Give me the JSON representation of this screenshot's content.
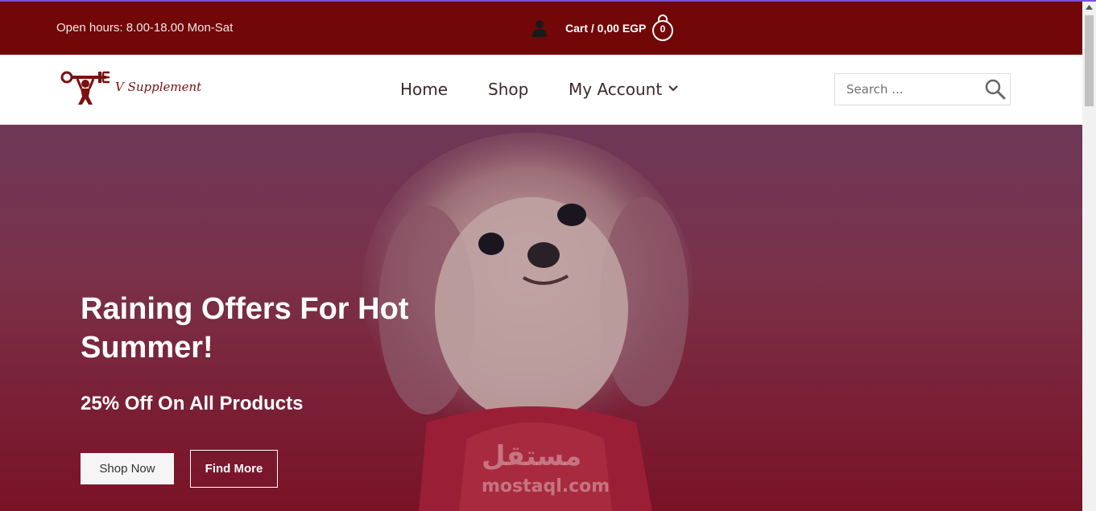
{
  "topbar": {
    "hours": "Open hours: 8.00-18.00 Mon-Sat",
    "cart_label": "Cart / 0,00 EGP",
    "cart_count": "0",
    "bg_color": "#720707"
  },
  "header": {
    "logo_text": "V Supplement",
    "nav": {
      "home": "Home",
      "shop": "Shop",
      "account": "My Account"
    },
    "search_placeholder": "Search ..."
  },
  "hero": {
    "title": "Raining Offers For Hot Summer!",
    "subtitle": "25% Off On All Products",
    "shop_button": "Shop Now",
    "find_button": "Find More",
    "watermark_ar": "مستقل",
    "watermark": "mostaql.com"
  },
  "icons": {
    "user": "user-icon",
    "cart": "shopping-bag-icon",
    "search": "search-icon",
    "chevron": "chevron-down-icon"
  }
}
